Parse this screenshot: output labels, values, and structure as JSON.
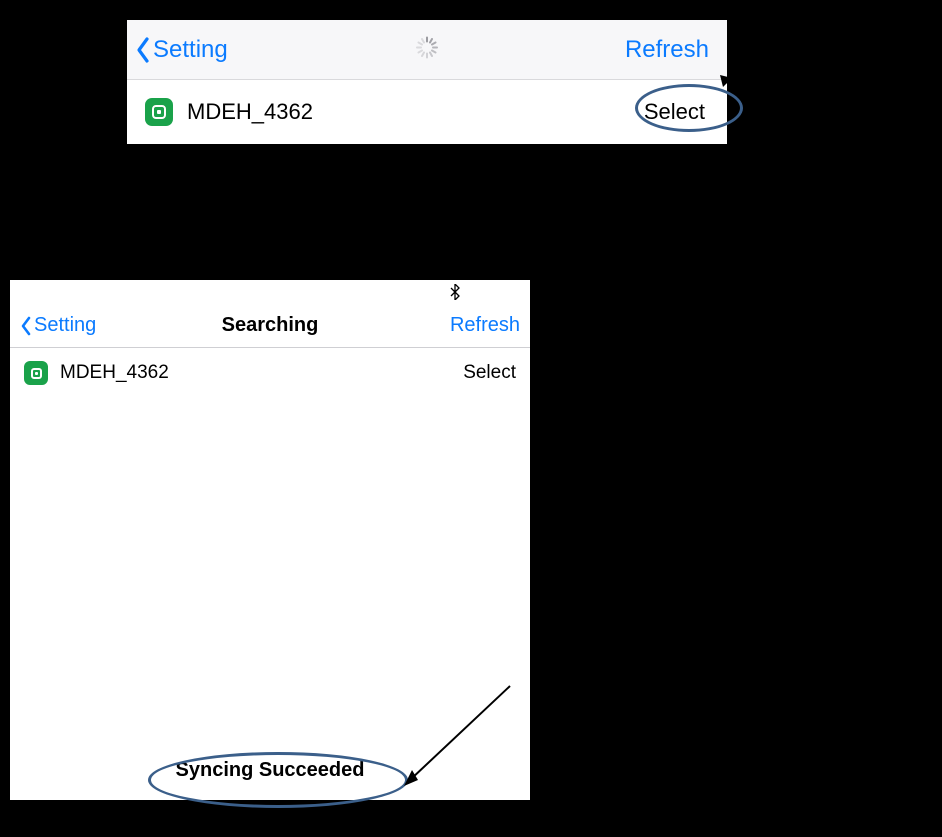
{
  "panel1": {
    "back_label": "Setting",
    "refresh_label": "Refresh",
    "device": {
      "name": "MDEH_4362",
      "action": "Select"
    }
  },
  "panel2": {
    "back_label": "Setting",
    "title": "Searching",
    "refresh_label": "Refresh",
    "device": {
      "name": "MDEH_4362",
      "action": "Select"
    },
    "sync_message": "Syncing Succeeded"
  }
}
